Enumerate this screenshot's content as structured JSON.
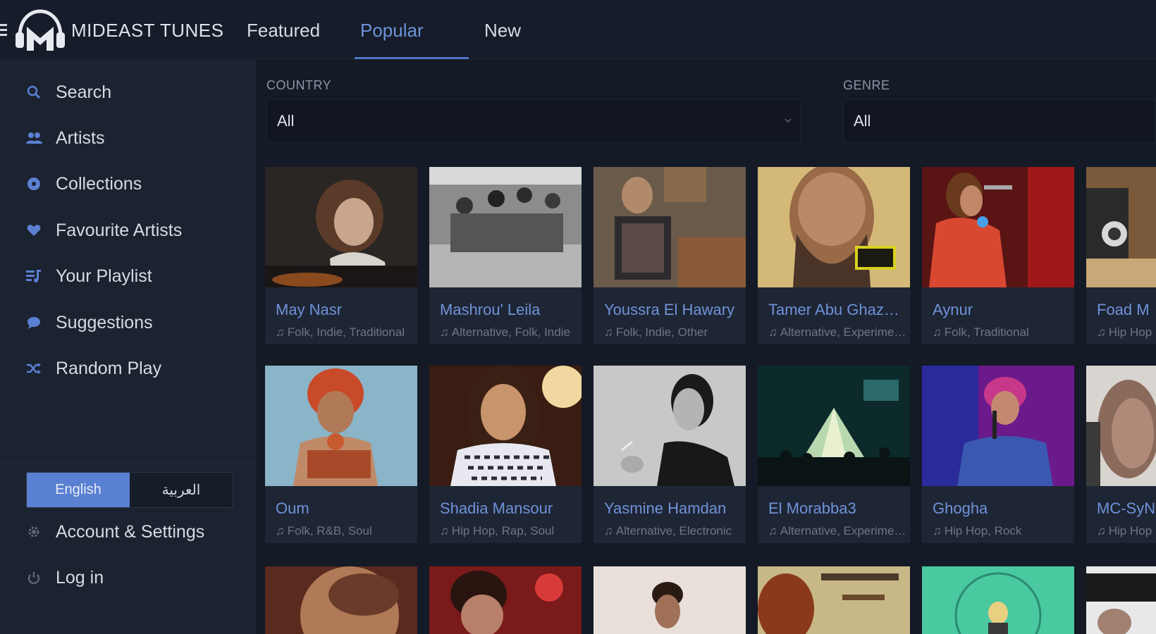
{
  "header": {
    "brand": "MIDEAST TUNES",
    "tabs": [
      {
        "label": "Featured"
      },
      {
        "label": "Popular",
        "active": true
      },
      {
        "label": "New"
      }
    ]
  },
  "sidebar": {
    "items": [
      {
        "label": "Search",
        "icon": "search-icon"
      },
      {
        "label": "Artists",
        "icon": "people-icon"
      },
      {
        "label": "Collections",
        "icon": "disc-icon"
      },
      {
        "label": "Favourite Artists",
        "icon": "heart-icon"
      },
      {
        "label": "Your Playlist",
        "icon": "playlist-icon"
      },
      {
        "label": "Suggestions",
        "icon": "chat-bubble-icon"
      },
      {
        "label": "Random Play",
        "icon": "shuffle-icon"
      }
    ],
    "language": {
      "english": "English",
      "arabic": "العربية",
      "selected": "English"
    },
    "bottom_items": [
      {
        "label": "Account & Settings",
        "icon": "gear-icon"
      },
      {
        "label": "Log in",
        "icon": "power-icon"
      }
    ]
  },
  "filters": {
    "country": {
      "label": "COUNTRY",
      "value": "All"
    },
    "genre": {
      "label": "GENRE",
      "value": "All"
    }
  },
  "artists": [
    {
      "name": "May Nasr",
      "genres": "Folk, Indie, Traditional"
    },
    {
      "name": "Mashrou' Leila",
      "genres": "Alternative, Folk, Indie"
    },
    {
      "name": "Youssra El Hawary",
      "genres": "Folk, Indie, Other"
    },
    {
      "name": "Tamer Abu Ghazaleh",
      "genres": "Alternative, Experimental"
    },
    {
      "name": "Aynur",
      "genres": "Folk, Traditional"
    },
    {
      "name": "Foad M",
      "genres": "Hip Hop"
    },
    {
      "name": "Oum",
      "genres": "Folk, R&B, Soul"
    },
    {
      "name": "Shadia Mansour",
      "genres": "Hip Hop, Rap, Soul"
    },
    {
      "name": "Yasmine Hamdan",
      "genres": "Alternative, Electronic"
    },
    {
      "name": "El Morabba3",
      "genres": "Alternative, Experimental"
    },
    {
      "name": "Ghogha",
      "genres": "Hip Hop, Rock"
    },
    {
      "name": "MC-SyN",
      "genres": "Hip Hop"
    }
  ],
  "colors": {
    "accent": "#5a80d2",
    "link": "#6f92d9",
    "sidebar": "#1b2230",
    "background": "#141a26"
  }
}
